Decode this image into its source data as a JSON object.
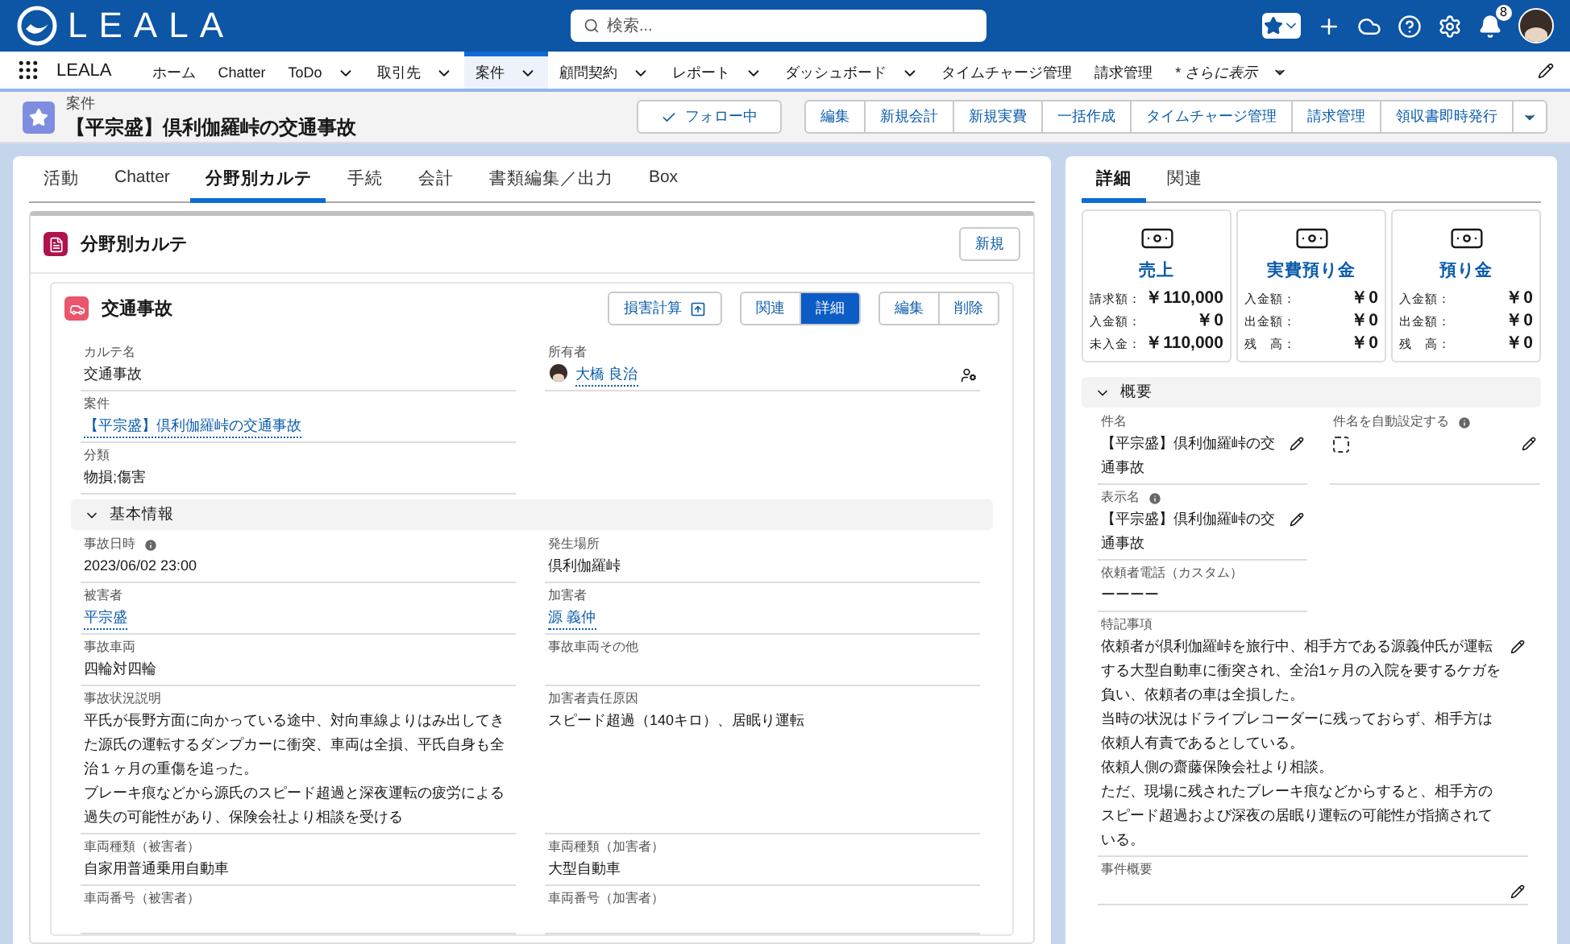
{
  "header": {
    "logo": "LEALA",
    "search_placeholder": "検索...",
    "notification_count": "8"
  },
  "nav": {
    "app_name": "LEALA",
    "items": [
      {
        "label": "ホーム",
        "dropdown": false,
        "selected": false
      },
      {
        "label": "Chatter",
        "dropdown": false,
        "selected": false
      },
      {
        "label": "ToDo",
        "dropdown": true,
        "selected": false
      },
      {
        "label": "取引先",
        "dropdown": true,
        "selected": false
      },
      {
        "label": "案件",
        "dropdown": true,
        "selected": true
      },
      {
        "label": "顧問契約",
        "dropdown": true,
        "selected": false
      },
      {
        "label": "レポート",
        "dropdown": true,
        "selected": false
      },
      {
        "label": "ダッシュボード",
        "dropdown": true,
        "selected": false
      },
      {
        "label": "タイムチャージ管理",
        "dropdown": false,
        "selected": false
      },
      {
        "label": "請求管理",
        "dropdown": false,
        "selected": false
      }
    ],
    "more": "* さらに表示"
  },
  "record": {
    "object_type": "案件",
    "title": "【平宗盛】倶利伽羅峠の交通事故",
    "follow": "フォロー中",
    "actions": [
      "編集",
      "新規会計",
      "新規実費",
      "一括作成",
      "タイムチャージ管理",
      "請求管理",
      "領収書即時発行"
    ]
  },
  "tabs": [
    {
      "label": "活動",
      "selected": false
    },
    {
      "label": "Chatter",
      "selected": false
    },
    {
      "label": "分野別カルテ",
      "selected": true
    },
    {
      "label": "手続",
      "selected": false
    },
    {
      "label": "会計",
      "selected": false
    },
    {
      "label": "書類編集／出力",
      "selected": false
    },
    {
      "label": "Box",
      "selected": false
    }
  ],
  "karte": {
    "title": "分野別カルテ",
    "new_button": "新規",
    "card": {
      "title": "交通事故",
      "calc_button": "損害計算",
      "view_buttons": [
        {
          "label": "関連",
          "selected": false
        },
        {
          "label": "詳細",
          "selected": true
        }
      ],
      "edit_buttons": [
        "編集",
        "削除"
      ],
      "left_fields": [
        {
          "label": "カルテ名",
          "value": "交通事故"
        },
        {
          "label": "案件",
          "value": "【平宗盛】倶利伽羅峠の交通事故",
          "link": true
        },
        {
          "label": "分類",
          "value": "物損;傷害"
        }
      ],
      "right_fields": [
        {
          "label": "所有者",
          "value": "大橋 良治",
          "link": true,
          "avatar": true,
          "change_owner": true
        }
      ],
      "section": {
        "title": "基本情報",
        "expanded": true,
        "rows": [
          [
            {
              "label": "事故日時",
              "value": "2023/06/02 23:00",
              "info": true
            },
            {
              "label": "発生場所",
              "value": "倶利伽羅峠"
            }
          ],
          [
            {
              "label": "被害者",
              "value": "平宗盛",
              "link": true
            },
            {
              "label": "加害者",
              "value": "源 義仲",
              "link": true
            }
          ],
          [
            {
              "label": "事故車両",
              "value": "四輪対四輪"
            },
            {
              "label": "事故車両その他"
            }
          ],
          [
            {
              "label": "事故状況説明",
              "paragraphs": [
                "平氏が長野方面に向かっている途中、対向車線よりはみ出してきた源氏の運転するダンプカーに衝突、車両は全損、平氏自身も全治１ヶ月の重傷を追った。",
                "ブレーキ痕などから源氏のスピード超過と深夜運転の疲労による過失の可能性があり、保険会社より相談を受ける"
              ]
            },
            {
              "label": "加害者責任原因",
              "value": "スピード超過（140キロ）、居眠り運転"
            }
          ],
          [
            {
              "label": "車両種類（被害者）",
              "value": "自家用普通乗用自動車"
            },
            {
              "label": "車両種類（加害者）",
              "value": "大型自動車"
            }
          ],
          [
            {
              "label": "車両番号（被害者）"
            },
            {
              "label": "車両番号（加害者）"
            }
          ]
        ]
      }
    }
  },
  "side": {
    "tabs": [
      {
        "label": "詳細",
        "selected": true
      },
      {
        "label": "関連",
        "selected": false
      }
    ],
    "money_cards": [
      {
        "title": "売上",
        "rows": [
          {
            "label": "請求額：",
            "value": "￥110,000"
          },
          {
            "label": "入金額：",
            "value": "￥0"
          },
          {
            "label": "未入金：",
            "value": "￥110,000"
          }
        ]
      },
      {
        "title": "実費預り金",
        "rows": [
          {
            "label": "入金額：",
            "value": "￥0"
          },
          {
            "label": "出金額：",
            "value": "￥0"
          },
          {
            "label": "残　高：",
            "value": "￥0"
          }
        ]
      },
      {
        "title": "預り金",
        "rows": [
          {
            "label": "入金額：",
            "value": "￥0"
          },
          {
            "label": "出金額：",
            "value": "￥0"
          },
          {
            "label": "残　高：",
            "value": "￥0"
          }
        ]
      }
    ],
    "section": {
      "title": "概要",
      "expanded": true,
      "rows": [
        [
          {
            "label": "件名",
            "value": "【平宗盛】倶利伽羅峠の交通事故",
            "editable": true
          },
          {
            "label": "件名を自動設定する",
            "info": true,
            "kind": "checkbox",
            "checked": false,
            "editable": true
          }
        ],
        [
          {
            "label": "表示名",
            "value": "【平宗盛】倶利伽羅峠の交通事故",
            "info": true,
            "editable": true
          }
        ],
        [
          {
            "label": "依頼者電話（カスタム）",
            "value": "ーーーー"
          }
        ]
      ],
      "wide_fields": [
        {
          "label": "特記事項",
          "paragraphs": [
            "依頼者が倶利伽羅峠を旅行中、相手方である源義仲氏が運転する大型自動車に衝突され、全治1ヶ月の入院を要するケガを負い、依頼者の車は全損した。",
            "当時の状況はドライブレコーダーに残っておらず、相手方は依頼人有責であるとしている。",
            "依頼人側の齋藤保険会社より相談。",
            "ただ、現場に残されたブレーキ痕などからすると、相手方のスピード超過および深夜の居眠り運転の可能性が指摘されている。"
          ],
          "editable": true
        },
        {
          "label": "事件概要",
          "editable": true
        }
      ]
    }
  }
}
